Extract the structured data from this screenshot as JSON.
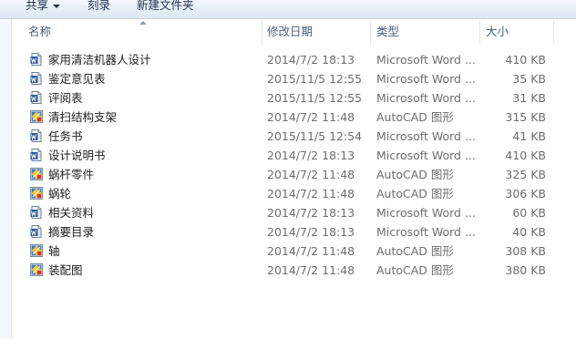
{
  "toolbar": {
    "share_label": "共享",
    "burn_label": "刻录",
    "new_folder_label": "新建文件夹"
  },
  "columns": {
    "name": "名称",
    "date": "修改日期",
    "type": "类型",
    "size": "大小"
  },
  "files": [
    {
      "name": "家用清洁机器人设计",
      "date": "2014/7/2 18:13",
      "type": "Microsoft Word ...",
      "size": "410 KB",
      "icon": "word-doc-icon"
    },
    {
      "name": "鉴定意见表",
      "date": "2015/11/5 12:55",
      "type": "Microsoft Word ...",
      "size": "35 KB",
      "icon": "word-doc-icon"
    },
    {
      "name": "评阅表",
      "date": "2015/11/5 12:55",
      "type": "Microsoft Word ...",
      "size": "31 KB",
      "icon": "word-doc-icon"
    },
    {
      "name": "清扫结构支架",
      "date": "2014/7/2 11:48",
      "type": "AutoCAD 图形",
      "size": "315 KB",
      "icon": "autocad-drawing-icon"
    },
    {
      "name": "任务书",
      "date": "2015/11/5 12:54",
      "type": "Microsoft Word ...",
      "size": "41 KB",
      "icon": "word-doc-icon"
    },
    {
      "name": "设计说明书",
      "date": "2014/7/2 18:13",
      "type": "Microsoft Word ...",
      "size": "410 KB",
      "icon": "word-doc-icon"
    },
    {
      "name": "蜗杆零件",
      "date": "2014/7/2 11:48",
      "type": "AutoCAD 图形",
      "size": "325 KB",
      "icon": "autocad-drawing-icon"
    },
    {
      "name": "蜗轮",
      "date": "2014/7/2 11:48",
      "type": "AutoCAD 图形",
      "size": "306 KB",
      "icon": "autocad-drawing-icon"
    },
    {
      "name": "相关资料",
      "date": "2014/7/2 18:13",
      "type": "Microsoft Word ...",
      "size": "60 KB",
      "icon": "word-doc-icon"
    },
    {
      "name": "摘要目录",
      "date": "2014/7/2 18:13",
      "type": "Microsoft Word ...",
      "size": "40 KB",
      "icon": "word-doc-icon"
    },
    {
      "name": "轴",
      "date": "2014/7/2 11:48",
      "type": "AutoCAD 图形",
      "size": "308 KB",
      "icon": "autocad-drawing-icon"
    },
    {
      "name": "装配图",
      "date": "2014/7/2 11:48",
      "type": "AutoCAD 图形",
      "size": "380 KB",
      "icon": "autocad-drawing-icon"
    }
  ]
}
